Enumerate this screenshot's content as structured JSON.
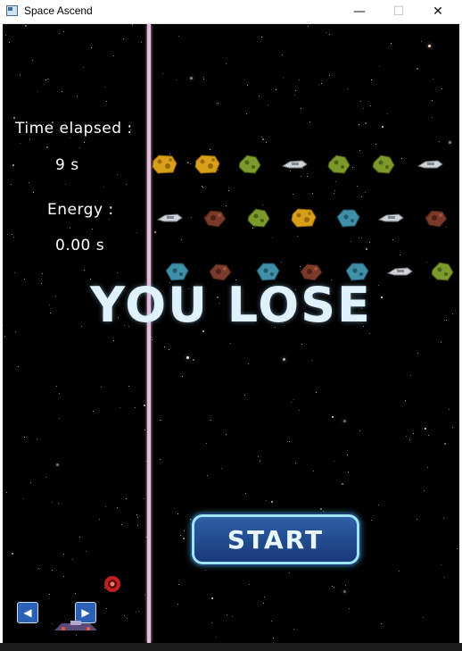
{
  "window": {
    "title": "Space Ascend",
    "minimize_icon": "—",
    "maximize_icon": "☐",
    "close_icon": "✕"
  },
  "hud": {
    "time_label": "Time elapsed :",
    "time_value": "9 s",
    "energy_label": "Energy :",
    "energy_value": "0.00 s"
  },
  "game": {
    "result_text": "YOU LOSE",
    "start_label": "START",
    "left_arrow": "◀",
    "right_arrow": "▶"
  },
  "colors": {
    "background": "#000000",
    "divider": "#e8b9d8",
    "result_text": "#dff2fb",
    "button_fill": "#23498f",
    "button_border": "#9ee5f7"
  },
  "asteroid_rows": [
    [
      "cheese-asteroid",
      "cheese-asteroid",
      "mossy-asteroid",
      "silver-ship",
      "mossy-asteroid",
      "mossy-asteroid",
      "silver-ship"
    ],
    [
      "silver-ship",
      "rocky-asteroid",
      "mossy-asteroid",
      "cheese-asteroid",
      "teal-asteroid",
      "silver-ship",
      "rocky-asteroid"
    ],
    [
      "teal-asteroid",
      "rocky-asteroid",
      "teal-asteroid",
      "rocky-asteroid",
      "teal-asteroid",
      "silver-ship",
      "mossy-asteroid"
    ]
  ]
}
